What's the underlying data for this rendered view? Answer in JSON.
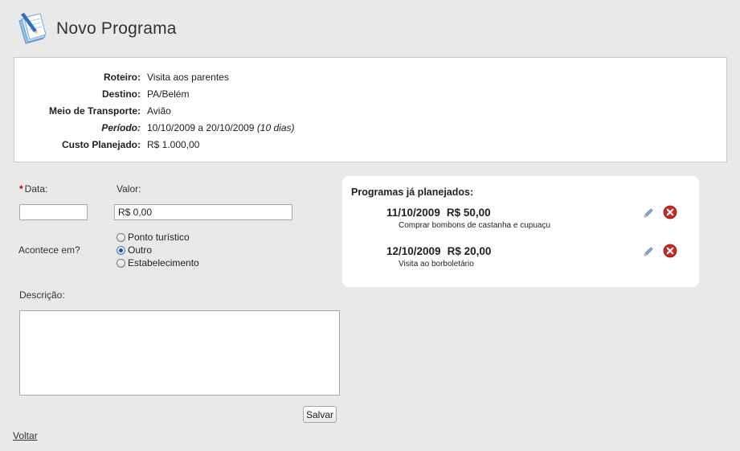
{
  "header": {
    "title": "Novo Programa",
    "logo_icon": "notebook-pencil-icon"
  },
  "info": {
    "roteiro": {
      "label": "Roteiro:",
      "value": "Visita aos parentes"
    },
    "destino": {
      "label": "Destino:",
      "value": "PA/Belém"
    },
    "transporte": {
      "label": "Meio de Transporte:",
      "value": "Avião"
    },
    "periodo": {
      "label": "Período:",
      "value": "10/10/2009 a 20/10/2009",
      "duration": "(10 dias)"
    },
    "custo": {
      "label": "Custo Planejado:",
      "value": "R$ 1.000,00"
    }
  },
  "form": {
    "data_required_mark": "*",
    "data_label": "Data:",
    "data_value": "",
    "valor_label": "Valor:",
    "valor_value": "R$ 0,00",
    "acontece_label": "Acontece em?",
    "options": [
      {
        "label": "Ponto turístico",
        "checked": false
      },
      {
        "label": "Outro",
        "checked": true
      },
      {
        "label": "Estabelecimento",
        "checked": false
      }
    ],
    "descricao_label": "Descrição:",
    "descricao_value": "",
    "save_label": "Salvar",
    "back_label": "Voltar"
  },
  "planned": {
    "title": "Programas já planejados:",
    "items": [
      {
        "date": "11/10/2009",
        "amount": "R$ 50,00",
        "description": "Comprar bombons de castanha e cupuaçu"
      },
      {
        "date": "12/10/2009",
        "amount": "R$ 20,00",
        "description": "Visita ao borboletário"
      }
    ],
    "edit_icon": "pencil-icon",
    "delete_icon": "delete-x-icon"
  },
  "colors": {
    "background": "#e9e9e9",
    "required": "#cc0000",
    "delete": "#c62828"
  }
}
